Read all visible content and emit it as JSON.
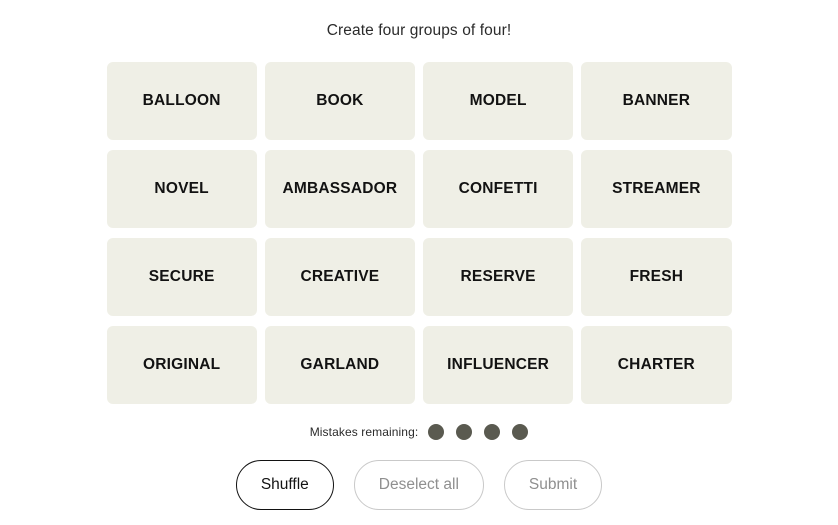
{
  "header": {
    "title": "Create four groups of four!"
  },
  "grid": {
    "rows": [
      [
        "BALLOON",
        "BOOK",
        "MODEL",
        "BANNER"
      ],
      [
        "NOVEL",
        "AMBASSADOR",
        "CONFETTI",
        "STREAMER"
      ],
      [
        "SECURE",
        "CREATIVE",
        "RESERVE",
        "FRESH"
      ],
      [
        "ORIGINAL",
        "GARLAND",
        "INFLUENCER",
        "CHARTER"
      ]
    ],
    "tile_color": "#EFEFE6",
    "text_color": "#121212"
  },
  "mistakes": {
    "label": "Mistakes remaining:",
    "count": 4,
    "dot_color": "#5A5A50"
  },
  "buttons": {
    "shuffle": {
      "label": "Shuffle",
      "state": "enabled"
    },
    "deselect_all": {
      "label": "Deselect all",
      "state": "disabled"
    },
    "submit": {
      "label": "Submit",
      "state": "disabled"
    }
  },
  "colors": {
    "background": "#FFFFFF",
    "enabled_border": "#121212",
    "disabled_border": "#C9C9C9",
    "disabled_text": "#8F8F8F"
  }
}
